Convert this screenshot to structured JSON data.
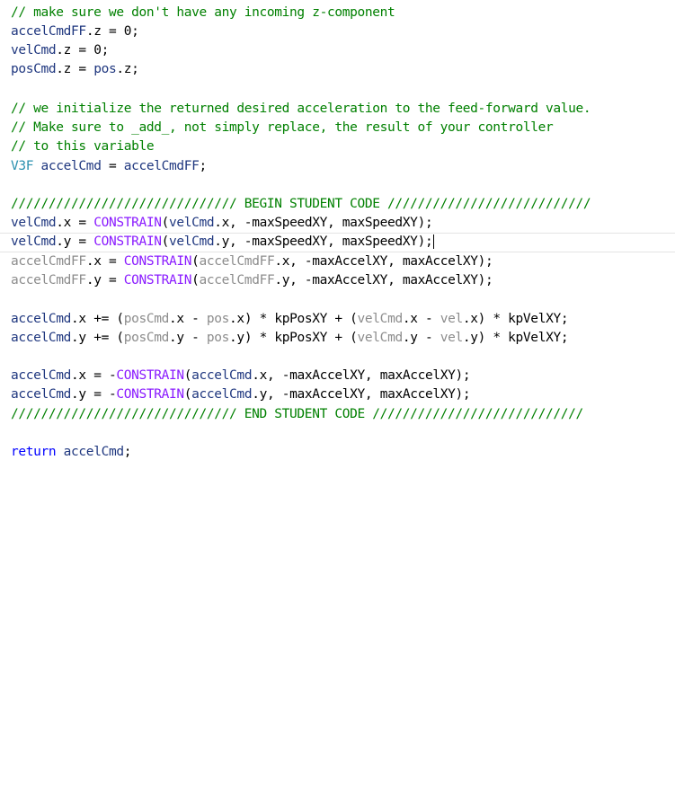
{
  "colors": {
    "background": "#ffffff",
    "comment": "#008000",
    "local_variable": "#1f377f",
    "type": "#2b91af",
    "macro": "#8a1bff",
    "keyword": "#0000ff",
    "plain": "#000000",
    "current_line_border": "#e4e4e4"
  },
  "code": {
    "comment_no_z": "// make sure we don't have any incoming z-component",
    "comment_init": "// we initialize the returned desired acceleration to the feed-forward value.",
    "comment_add": "// Make sure to _add_, not simply replace, the result of your controller",
    "comment_var": "// to this variable",
    "begin_marker": "////////////////////////////// BEGIN STUDENT CODE ///////////////////////////",
    "end_marker": "////////////////////////////// END STUDENT CODE ////////////////////////////",
    "tokens": {
      "accelCmdFF": "accelCmdFF",
      "accelCmd": "accelCmd",
      "velCmd": "velCmd",
      "posCmd": "posCmd",
      "pos": "pos",
      "vel": "vel",
      "V3F": "V3F",
      "CONSTRAIN": "CONSTRAIN",
      "return_kw": "return",
      "maxSpeedXY": "maxSpeedXY",
      "maxAccelXY": "maxAccelXY",
      "kpPosXY": "kpPosXY",
      "kpVelXY": "kpVelXY",
      "zero": "0",
      "dot_x": ".x",
      "dot_y": ".y",
      "dot_z": ".z"
    }
  }
}
